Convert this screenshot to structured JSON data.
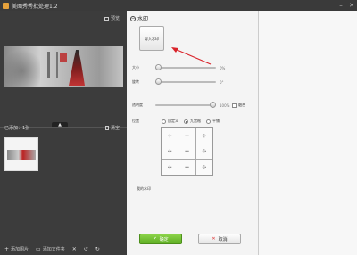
{
  "window": {
    "title": "美图秀秀批处理1.2",
    "minimize": "–",
    "close": "✕"
  },
  "left": {
    "preview_label": "预览",
    "collapse_icon": "▲",
    "added_label": "已添加：1张",
    "clear_label": "清空",
    "bottom": {
      "add_image": "添加图片",
      "add_folder": "添加文件夹"
    }
  },
  "watermark": {
    "section_title": "水印",
    "import_label": "导入水印",
    "size_label": "大小",
    "size_value": "0%",
    "size_level": 0.0,
    "rotate_label": "旋转",
    "rotate_value": "0°",
    "rotate_level": 0.0,
    "opacity_label": "透明度",
    "opacity_value": "100%",
    "opacity_level": 1.0,
    "tile_label": "融合",
    "position_label": "位置",
    "positions": [
      "自定义",
      "九宫格",
      "平铺"
    ],
    "position_selected": "九宫格",
    "my_watermark_label": "我的水印",
    "ok_label": "确定",
    "cancel_label": "取消"
  },
  "colors": {
    "accent_green": "#5fae24",
    "arrow_red": "#d9232a",
    "dark_panel": "#3c3c3c"
  }
}
